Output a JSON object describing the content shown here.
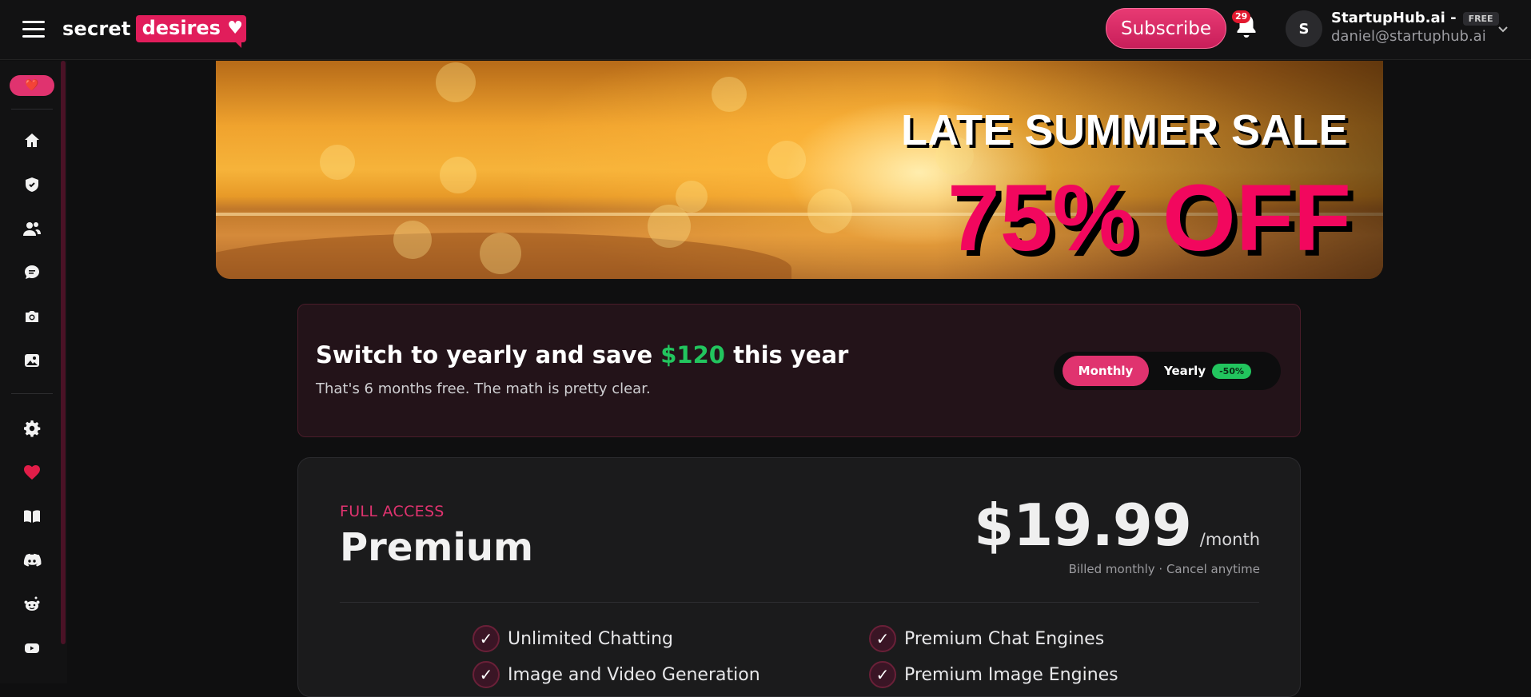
{
  "header": {
    "logo_word1": "secret",
    "logo_word2": "desires",
    "subscribe_label": "Subscribe",
    "notification_count": "29",
    "avatar_initial": "S",
    "user_name": "StartupHub.ai -",
    "plan_badge": "FREE",
    "user_email": "daniel@startuphub.ai"
  },
  "sidebar": {
    "items": [
      {
        "name": "home",
        "icon": "home-icon"
      },
      {
        "name": "favorites",
        "icon": "heart-badge-icon"
      },
      {
        "name": "characters",
        "icon": "users-icon"
      },
      {
        "name": "chat",
        "icon": "chat-icon"
      },
      {
        "name": "camera",
        "icon": "camera-icon"
      },
      {
        "name": "gallery",
        "icon": "gallery-icon"
      },
      {
        "name": "settings",
        "icon": "gear-icon"
      },
      {
        "name": "likes",
        "icon": "heart-icon"
      },
      {
        "name": "guide",
        "icon": "book-icon"
      },
      {
        "name": "discord",
        "icon": "discord-icon"
      },
      {
        "name": "reddit",
        "icon": "reddit-icon"
      },
      {
        "name": "youtube",
        "icon": "youtube-icon"
      }
    ]
  },
  "banner": {
    "title": "LATE SUMMER SALE",
    "discount": "75% OFF"
  },
  "billing": {
    "title_prefix": "Switch to yearly and save ",
    "title_amount": "$120",
    "title_suffix": " this year",
    "subtitle": "That's 6 months free. The math is pretty clear.",
    "monthly_label": "Monthly",
    "yearly_label": "Yearly",
    "yearly_discount": "-50%",
    "selected": "Monthly"
  },
  "plan": {
    "kicker": "FULL ACCESS",
    "name": "Premium",
    "price": "$19.99",
    "period": "/month",
    "billed_note": "Billed monthly · Cancel anytime",
    "features": [
      "Unlimited Chatting",
      "Premium Chat Engines",
      "Image and Video Generation",
      "Premium Image Engines"
    ]
  },
  "colors": {
    "accent": "#e0336f",
    "savings_green": "#22c55e",
    "sale_pink": "#f2075e"
  }
}
